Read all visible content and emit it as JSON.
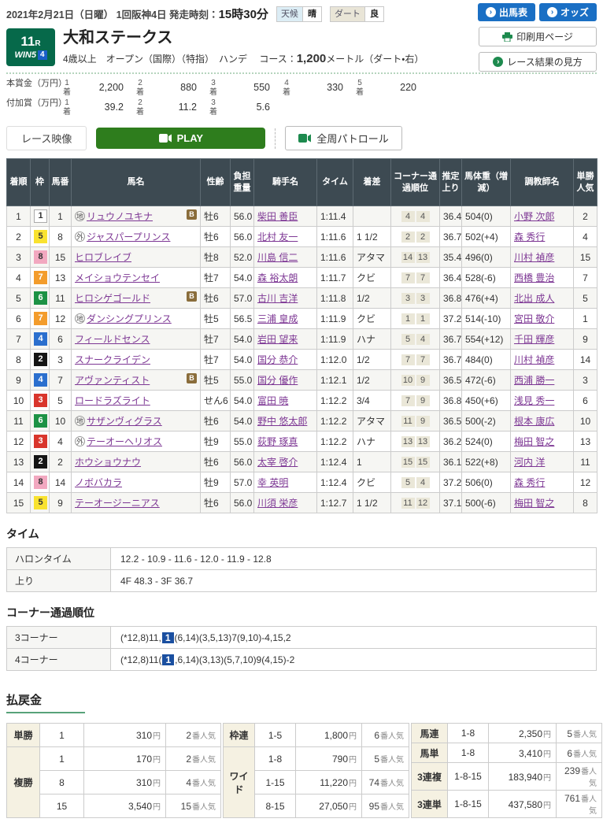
{
  "icons": {
    "chevron": "›"
  },
  "colors": {
    "accent_blue": "#1a6fc4",
    "jra_green": "#06694a",
    "play_green": "#2e7d1d",
    "link_purple": "#7d3794",
    "header_slate": "#3d4a52",
    "frame": {
      "1": "#ffffff",
      "2": "#151515",
      "3": "#d9352c",
      "4": "#2b6fce",
      "5": "#f9e22f",
      "6": "#1c9245",
      "7": "#f39c2c",
      "8": "#f2a8c0"
    }
  },
  "header": {
    "date": "2021年2月21日（日曜）",
    "meeting": "1回阪神4日",
    "start_label": "発走時刻：",
    "start_time": "15時30分",
    "weather_label": "天候",
    "weather_value": "晴",
    "track_label": "ダート",
    "track_value": "良",
    "buttons": {
      "entries": "出馬表",
      "odds": "オッズ",
      "print": "印刷用ページ",
      "guide": "レース結果の見方"
    }
  },
  "race": {
    "number": "11",
    "number_suffix": "R",
    "win5": "WIN5",
    "win5_num": "4",
    "title": "大和ステークス",
    "conditions": "4歳以上　オープン（国際）（特指）　ハンデ　",
    "course_label": "コース：",
    "course_value": "1,200",
    "course_unit": "メートル（ダート・右）"
  },
  "prizes": {
    "chaku": "着",
    "main_label": "本賞金（万円）",
    "main": [
      {
        "place": "1",
        "value": "2,200"
      },
      {
        "place": "2",
        "value": "880"
      },
      {
        "place": "3",
        "value": "550"
      },
      {
        "place": "4",
        "value": "330"
      },
      {
        "place": "5",
        "value": "220"
      }
    ],
    "added_label": "付加賞（万円）",
    "added": [
      {
        "place": "1",
        "value": "39.2"
      },
      {
        "place": "2",
        "value": "11.2"
      },
      {
        "place": "3",
        "value": "5.6"
      }
    ]
  },
  "video": {
    "race_video": "レース映像",
    "play": "PLAY",
    "patrol": "全周パトロール"
  },
  "results": {
    "headers": [
      "着順",
      "枠",
      "馬番",
      "馬名",
      "性齢",
      "負担重量",
      "騎手名",
      "タイム",
      "着差",
      "コーナー通過順位",
      "推定上り",
      "馬体重（増減）",
      "調教師名",
      "単勝人気"
    ],
    "rows": [
      {
        "finish": "1",
        "frame": "1",
        "num": "1",
        "mark": "地",
        "name": "リュウノユキナ",
        "blinker": "B",
        "sex_age": "牡6",
        "weight": "56.0",
        "jockey": "柴田 善臣",
        "time": "1:11.4",
        "margin": "",
        "corner1": "4",
        "corner2": "4",
        "last3f": "36.4",
        "horse_weight": "504(0)",
        "trainer": "小野 次郎",
        "pop": "2"
      },
      {
        "finish": "2",
        "frame": "5",
        "num": "8",
        "mark": "外",
        "name": "ジャスパープリンス",
        "blinker": "",
        "sex_age": "牡6",
        "weight": "56.0",
        "jockey": "北村 友一",
        "time": "1:11.6",
        "margin": "1 1/2",
        "corner1": "2",
        "corner2": "2",
        "last3f": "36.7",
        "horse_weight": "502(+4)",
        "trainer": "森 秀行",
        "pop": "4"
      },
      {
        "finish": "3",
        "frame": "8",
        "num": "15",
        "mark": "",
        "name": "ヒロブレイブ",
        "blinker": "",
        "sex_age": "牡8",
        "weight": "52.0",
        "jockey": "川島 信二",
        "time": "1:11.6",
        "margin": "アタマ",
        "corner1": "14",
        "corner2": "13",
        "last3f": "35.4",
        "horse_weight": "496(0)",
        "trainer": "川村 禎彦",
        "pop": "15"
      },
      {
        "finish": "4",
        "frame": "7",
        "num": "13",
        "mark": "",
        "name": "メイショウテンセイ",
        "blinker": "",
        "sex_age": "牡7",
        "weight": "54.0",
        "jockey": "森 裕太朗",
        "time": "1:11.7",
        "margin": "クビ",
        "corner1": "7",
        "corner2": "7",
        "last3f": "36.4",
        "horse_weight": "528(-6)",
        "trainer": "西橋 豊治",
        "pop": "7"
      },
      {
        "finish": "5",
        "frame": "6",
        "num": "11",
        "mark": "",
        "name": "ヒロシゲゴールド",
        "blinker": "B",
        "sex_age": "牡6",
        "weight": "57.0",
        "jockey": "古川 吉洋",
        "time": "1:11.8",
        "margin": "1/2",
        "corner1": "3",
        "corner2": "3",
        "last3f": "36.8",
        "horse_weight": "476(+4)",
        "trainer": "北出 成人",
        "pop": "5"
      },
      {
        "finish": "6",
        "frame": "7",
        "num": "12",
        "mark": "地",
        "name": "ダンシングプリンス",
        "blinker": "",
        "sex_age": "牡5",
        "weight": "56.5",
        "jockey": "三浦 皇成",
        "time": "1:11.9",
        "margin": "クビ",
        "corner1": "1",
        "corner2": "1",
        "last3f": "37.2",
        "horse_weight": "514(-10)",
        "trainer": "宮田 敬介",
        "pop": "1"
      },
      {
        "finish": "7",
        "frame": "4",
        "num": "6",
        "mark": "",
        "name": "フィールドセンス",
        "blinker": "",
        "sex_age": "牡7",
        "weight": "54.0",
        "jockey": "岩田 望来",
        "time": "1:11.9",
        "margin": "ハナ",
        "corner1": "5",
        "corner2": "4",
        "last3f": "36.7",
        "horse_weight": "554(+12)",
        "trainer": "千田 輝彦",
        "pop": "9"
      },
      {
        "finish": "8",
        "frame": "2",
        "num": "3",
        "mark": "",
        "name": "スナークライデン",
        "blinker": "",
        "sex_age": "牡7",
        "weight": "54.0",
        "jockey": "国分 恭介",
        "time": "1:12.0",
        "margin": "1/2",
        "corner1": "7",
        "corner2": "7",
        "last3f": "36.7",
        "horse_weight": "484(0)",
        "trainer": "川村 禎彦",
        "pop": "14"
      },
      {
        "finish": "9",
        "frame": "4",
        "num": "7",
        "mark": "",
        "name": "アヴァンティスト",
        "blinker": "B",
        "sex_age": "牡5",
        "weight": "55.0",
        "jockey": "国分 優作",
        "time": "1:12.1",
        "margin": "1/2",
        "corner1": "10",
        "corner2": "9",
        "last3f": "36.5",
        "horse_weight": "472(-6)",
        "trainer": "西浦 勝一",
        "pop": "3"
      },
      {
        "finish": "10",
        "frame": "3",
        "num": "5",
        "mark": "",
        "name": "ロードラズライト",
        "blinker": "",
        "sex_age": "せん6",
        "weight": "54.0",
        "jockey": "富田 暁",
        "time": "1:12.2",
        "margin": "3/4",
        "corner1": "7",
        "corner2": "9",
        "last3f": "36.8",
        "horse_weight": "450(+6)",
        "trainer": "浅見 秀一",
        "pop": "6"
      },
      {
        "finish": "11",
        "frame": "6",
        "num": "10",
        "mark": "地",
        "name": "サザンヴィグラス",
        "blinker": "",
        "sex_age": "牡6",
        "weight": "54.0",
        "jockey": "野中 悠太郎",
        "time": "1:12.2",
        "margin": "アタマ",
        "corner1": "11",
        "corner2": "9",
        "last3f": "36.5",
        "horse_weight": "500(-2)",
        "trainer": "根本 康広",
        "pop": "10"
      },
      {
        "finish": "12",
        "frame": "3",
        "num": "4",
        "mark": "外",
        "name": "テーオーヘリオス",
        "blinker": "",
        "sex_age": "牡9",
        "weight": "55.0",
        "jockey": "荻野 琢真",
        "time": "1:12.2",
        "margin": "ハナ",
        "corner1": "13",
        "corner2": "13",
        "last3f": "36.2",
        "horse_weight": "524(0)",
        "trainer": "梅田 智之",
        "pop": "13"
      },
      {
        "finish": "13",
        "frame": "2",
        "num": "2",
        "mark": "",
        "name": "ホウショウナウ",
        "blinker": "",
        "sex_age": "牡6",
        "weight": "56.0",
        "jockey": "太宰 啓介",
        "time": "1:12.4",
        "margin": "1",
        "corner1": "15",
        "corner2": "15",
        "last3f": "36.1",
        "horse_weight": "522(+8)",
        "trainer": "河内 洋",
        "pop": "11"
      },
      {
        "finish": "14",
        "frame": "8",
        "num": "14",
        "mark": "",
        "name": "ノボバカラ",
        "blinker": "",
        "sex_age": "牡9",
        "weight": "57.0",
        "jockey": "幸 英明",
        "time": "1:12.4",
        "margin": "クビ",
        "corner1": "5",
        "corner2": "4",
        "last3f": "37.2",
        "horse_weight": "506(0)",
        "trainer": "森 秀行",
        "pop": "12"
      },
      {
        "finish": "15",
        "frame": "5",
        "num": "9",
        "mark": "",
        "name": "テーオージーニアス",
        "blinker": "",
        "sex_age": "牡6",
        "weight": "56.0",
        "jockey": "川須 栄彦",
        "time": "1:12.7",
        "margin": "1 1/2",
        "corner1": "11",
        "corner2": "12",
        "last3f": "37.1",
        "horse_weight": "500(-6)",
        "trainer": "梅田 智之",
        "pop": "8"
      }
    ]
  },
  "time_section": {
    "title": "タイム",
    "rows": [
      {
        "label": "ハロンタイム",
        "value": "12.2 - 10.9 - 11.6 - 12.0 - 11.9 - 12.8"
      },
      {
        "label": "上り",
        "value": "4F 48.3 - 3F 36.7"
      }
    ]
  },
  "corner_section": {
    "title": "コーナー通過順位",
    "rows": [
      {
        "label": "3コーナー",
        "pre": "(*12,8)11,",
        "win": "1",
        "post": "(6,14)(3,5,13)7(9,10)-4,15,2"
      },
      {
        "label": "4コーナー",
        "pre": "(*12,8)11(",
        "win": "1",
        "post": ",6,14)(3,13)(5,7,10)9(4,15)-2"
      }
    ]
  },
  "payout": {
    "title": "払戻金",
    "yen": "円",
    "ninki": "番人気",
    "groups": [
      {
        "rows": [
          {
            "type": "単勝",
            "span": 1,
            "comb": "1",
            "amount": "310",
            "pop": "2"
          },
          {
            "type": "複勝",
            "span": 3,
            "comb": "1",
            "amount": "170",
            "pop": "2"
          },
          {
            "comb": "8",
            "amount": "310",
            "pop": "4"
          },
          {
            "comb": "15",
            "amount": "3,540",
            "pop": "15"
          }
        ]
      },
      {
        "rows": [
          {
            "type": "枠連",
            "span": 1,
            "comb": "1-5",
            "amount": "1,800",
            "pop": "6"
          },
          {
            "type": "ワイド",
            "span": 3,
            "comb": "1-8",
            "amount": "790",
            "pop": "5"
          },
          {
            "comb": "1-15",
            "amount": "11,220",
            "pop": "74"
          },
          {
            "comb": "8-15",
            "amount": "27,050",
            "pop": "95"
          }
        ]
      },
      {
        "rows": [
          {
            "type": "馬連",
            "span": 1,
            "comb": "1-8",
            "amount": "2,350",
            "pop": "5"
          },
          {
            "type": "馬単",
            "span": 1,
            "comb": "1-8",
            "amount": "3,410",
            "pop": "6"
          },
          {
            "type": "3連複",
            "span": 1,
            "comb": "1-8-15",
            "amount": "183,940",
            "pop": "239"
          },
          {
            "type": "3連単",
            "span": 1,
            "comb": "1-8-15",
            "amount": "437,580",
            "pop": "761"
          }
        ]
      }
    ]
  }
}
